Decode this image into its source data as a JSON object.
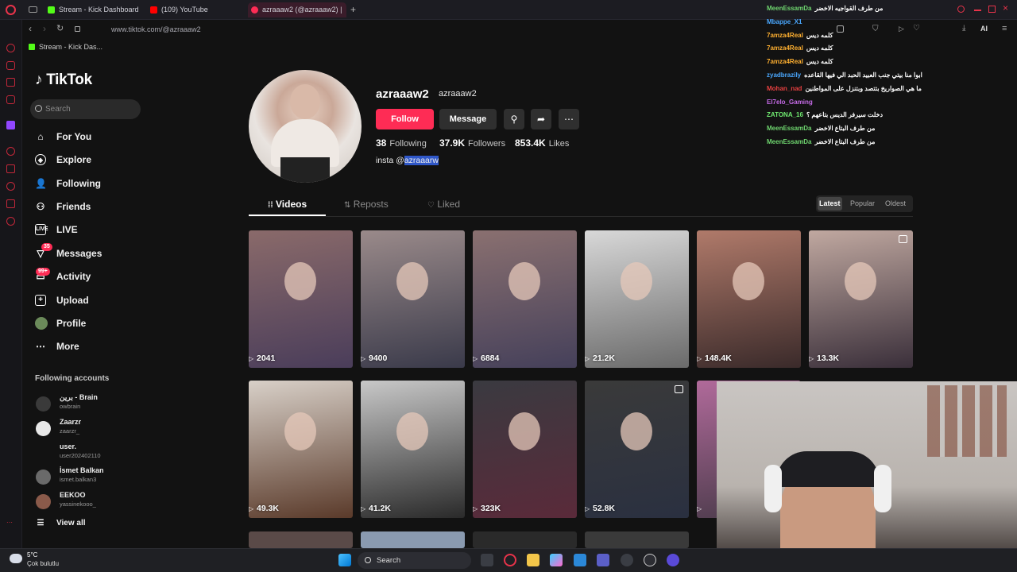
{
  "browser": {
    "tabs": [
      {
        "label": "Stream - Kick Dashboard",
        "color": "#53fc18"
      },
      {
        "label": "(109) YouTube",
        "color": "#ff0000"
      },
      {
        "label": "azraaaw2 (@azraaaw2) |",
        "color": "#fe2c55"
      }
    ],
    "url": "www.tiktok.com/@azraaaw2",
    "bookmark": "Stream - Kick Das..."
  },
  "sidebar": {
    "logo": "TikTok",
    "search_placeholder": "Search",
    "nav": [
      {
        "label": "For You",
        "icon": "home-icon"
      },
      {
        "label": "Explore",
        "icon": "compass-icon"
      },
      {
        "label": "Following",
        "icon": "following-icon"
      },
      {
        "label": "Friends",
        "icon": "friends-icon"
      },
      {
        "label": "LIVE",
        "icon": "live-icon"
      },
      {
        "label": "Messages",
        "icon": "messages-icon",
        "badge": "35"
      },
      {
        "label": "Activity",
        "icon": "activity-icon",
        "badge": "99+"
      },
      {
        "label": "Upload",
        "icon": "upload-icon"
      },
      {
        "label": "Profile",
        "icon": "avatar"
      },
      {
        "label": "More",
        "icon": "more-icon"
      }
    ],
    "following_title": "Following accounts",
    "following_accounts": [
      {
        "name": "برين - Brain",
        "handle": "owbrain"
      },
      {
        "name": "Zaarzr",
        "handle": "zaarzr_"
      },
      {
        "name": "user.",
        "handle": "user202402110"
      },
      {
        "name": "İsmet Balkan",
        "handle": "ismet.balkan3"
      },
      {
        "name": "EEKOO",
        "handle": "yassinekooo_"
      }
    ],
    "view_all": "View all"
  },
  "profile": {
    "username": "azraaaw2",
    "nickname": "azraaaw2",
    "follow_label": "Follow",
    "message_label": "Message",
    "following_count": "38",
    "following_label": "Following",
    "followers_count": "37.9K",
    "followers_label": "Followers",
    "likes_count": "853.4K",
    "likes_label": "Likes",
    "bio_prefix": "insta @",
    "bio_highlight": "azraaarw"
  },
  "tabs": {
    "videos": "Videos",
    "reposts": "Reposts",
    "liked": "Liked"
  },
  "sort": {
    "latest": "Latest",
    "popular": "Popular",
    "oldest": "Oldest"
  },
  "videos": [
    {
      "views": "2041",
      "c1": "#8a6a6a",
      "c2": "#4a3d5a"
    },
    {
      "views": "9400",
      "c1": "#9a8a8a",
      "c2": "#3a3a4a"
    },
    {
      "views": "6884",
      "c1": "#8a7070",
      "c2": "#45405a"
    },
    {
      "views": "21.2K",
      "c1": "#d8d8d8",
      "c2": "#6a6a6a"
    },
    {
      "views": "148.4K",
      "c1": "#b07a6a",
      "c2": "#3a2a2a"
    },
    {
      "views": "13.3K",
      "c1": "#c0a8a0",
      "c2": "#3a2f3a",
      "pinned": true
    },
    {
      "views": "49.3K",
      "c1": "#d8d0c8",
      "c2": "#5a3a2a"
    },
    {
      "views": "41.2K",
      "c1": "#c8c8c8",
      "c2": "#2a2a2a"
    },
    {
      "views": "323K",
      "c1": "#3a3a40",
      "c2": "#5a2a3a"
    },
    {
      "views": "52.8K",
      "c1": "#3a3a3a",
      "c2": "#2a3040",
      "pinned": true
    },
    {
      "views": "",
      "c1": "#b06a9a",
      "c2": "#4a3a4a"
    }
  ],
  "chat": [
    {
      "name": "MeenEssamDa",
      "color": "#6fd66f",
      "msg": "من طرف القواجيه الاخضر"
    },
    {
      "name": "Mbappe_X1",
      "color": "#4aa8ff",
      "msg": ""
    },
    {
      "name": "7amza4Real",
      "color": "#ffb030",
      "msg": "كلمه ديس"
    },
    {
      "name": "7amza4Real",
      "color": "#ffb030",
      "msg": "كلمه ديس"
    },
    {
      "name": "7amza4Real",
      "color": "#ffb030",
      "msg": "كلمه ديس"
    },
    {
      "name": "zyadbrazily",
      "color": "#4aa8ff",
      "msg": "ابوا منا بيتي جنب العبيد الحبد الي فيها القاعده"
    },
    {
      "name": "Mohan_nad",
      "color": "#e84040",
      "msg": "ما هي الصواريخ بتتصد وبتنزل على المواطنين"
    },
    {
      "name": "El7elo_Gaming",
      "color": "#c66be8",
      "msg": ""
    },
    {
      "name": "ZATONA_16",
      "color": "#6fe86f",
      "msg": "دخلت سيرفر الديس بتاعهم ؟"
    },
    {
      "name": "MeenEssamDa",
      "color": "#6fd66f",
      "msg": "من طرف البتاع الاخضر"
    },
    {
      "name": "MeenEssamDa",
      "color": "#6fd66f",
      "msg": "من طرف البتاع الاخضر"
    }
  ],
  "taskbar": {
    "temp": "5°C",
    "weather": "Çok bulutlu",
    "search": "Search"
  },
  "colors": {
    "accent": "#fe2c55",
    "background": "#121212"
  }
}
